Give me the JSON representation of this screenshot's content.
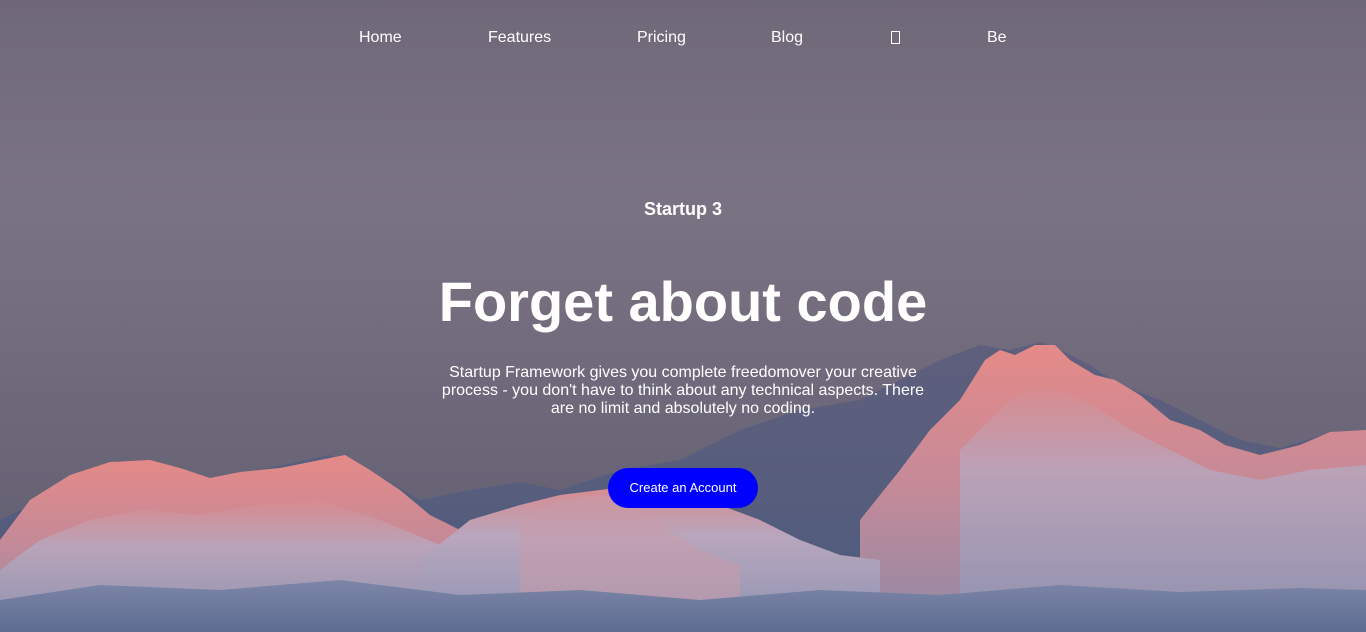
{
  "nav": {
    "items": [
      {
        "label": "Home"
      },
      {
        "label": "Features"
      },
      {
        "label": "Pricing"
      },
      {
        "label": "Blog"
      },
      {
        "label": "Be"
      }
    ],
    "icon": "missing-glyph-icon"
  },
  "hero": {
    "eyebrow": "Startup 3",
    "headline": "Forget about code",
    "subtext": "Startup Framework gives you complete freedomover your creative process - you don't have to think about any technical aspects. There are no limit and absolutely no coding.",
    "cta_label": "Create an Account",
    "background_image": "mountain-sunset-image"
  },
  "colors": {
    "cta_background": "#0000ff",
    "text": "#ffffff",
    "sky": "#75707f"
  }
}
